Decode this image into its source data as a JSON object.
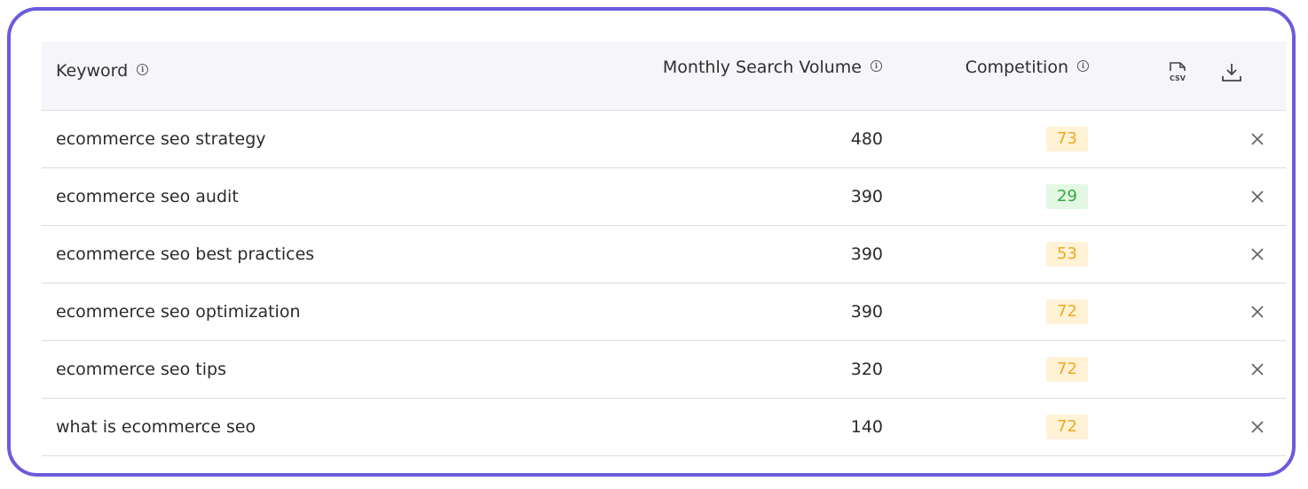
{
  "table": {
    "headers": {
      "keyword": "Keyword",
      "volume": "Monthly Search Volume",
      "competition": "Competition"
    },
    "actions": {
      "csv_icon": "csv-file-icon",
      "download_icon": "download-icon",
      "csv_label": "CSV"
    },
    "rows": [
      {
        "keyword": "ecommerce seo strategy",
        "volume": "480",
        "competition": "73",
        "level": "medium"
      },
      {
        "keyword": "ecommerce seo audit",
        "volume": "390",
        "competition": "29",
        "level": "low"
      },
      {
        "keyword": "ecommerce seo best practices",
        "volume": "390",
        "competition": "53",
        "level": "medium"
      },
      {
        "keyword": "ecommerce seo optimization",
        "volume": "390",
        "competition": "72",
        "level": "medium"
      },
      {
        "keyword": "ecommerce seo tips",
        "volume": "320",
        "competition": "72",
        "level": "medium"
      },
      {
        "keyword": "what is ecommerce seo",
        "volume": "140",
        "competition": "72",
        "level": "medium"
      }
    ]
  },
  "colors": {
    "frame_border": "#6b5bdc",
    "header_bg": "#f5f5fa",
    "competition_medium_bg": "#fff2d6",
    "competition_medium_text": "#f0a81f",
    "competition_low_bg": "#e3f8e3",
    "competition_low_text": "#34a93a"
  }
}
